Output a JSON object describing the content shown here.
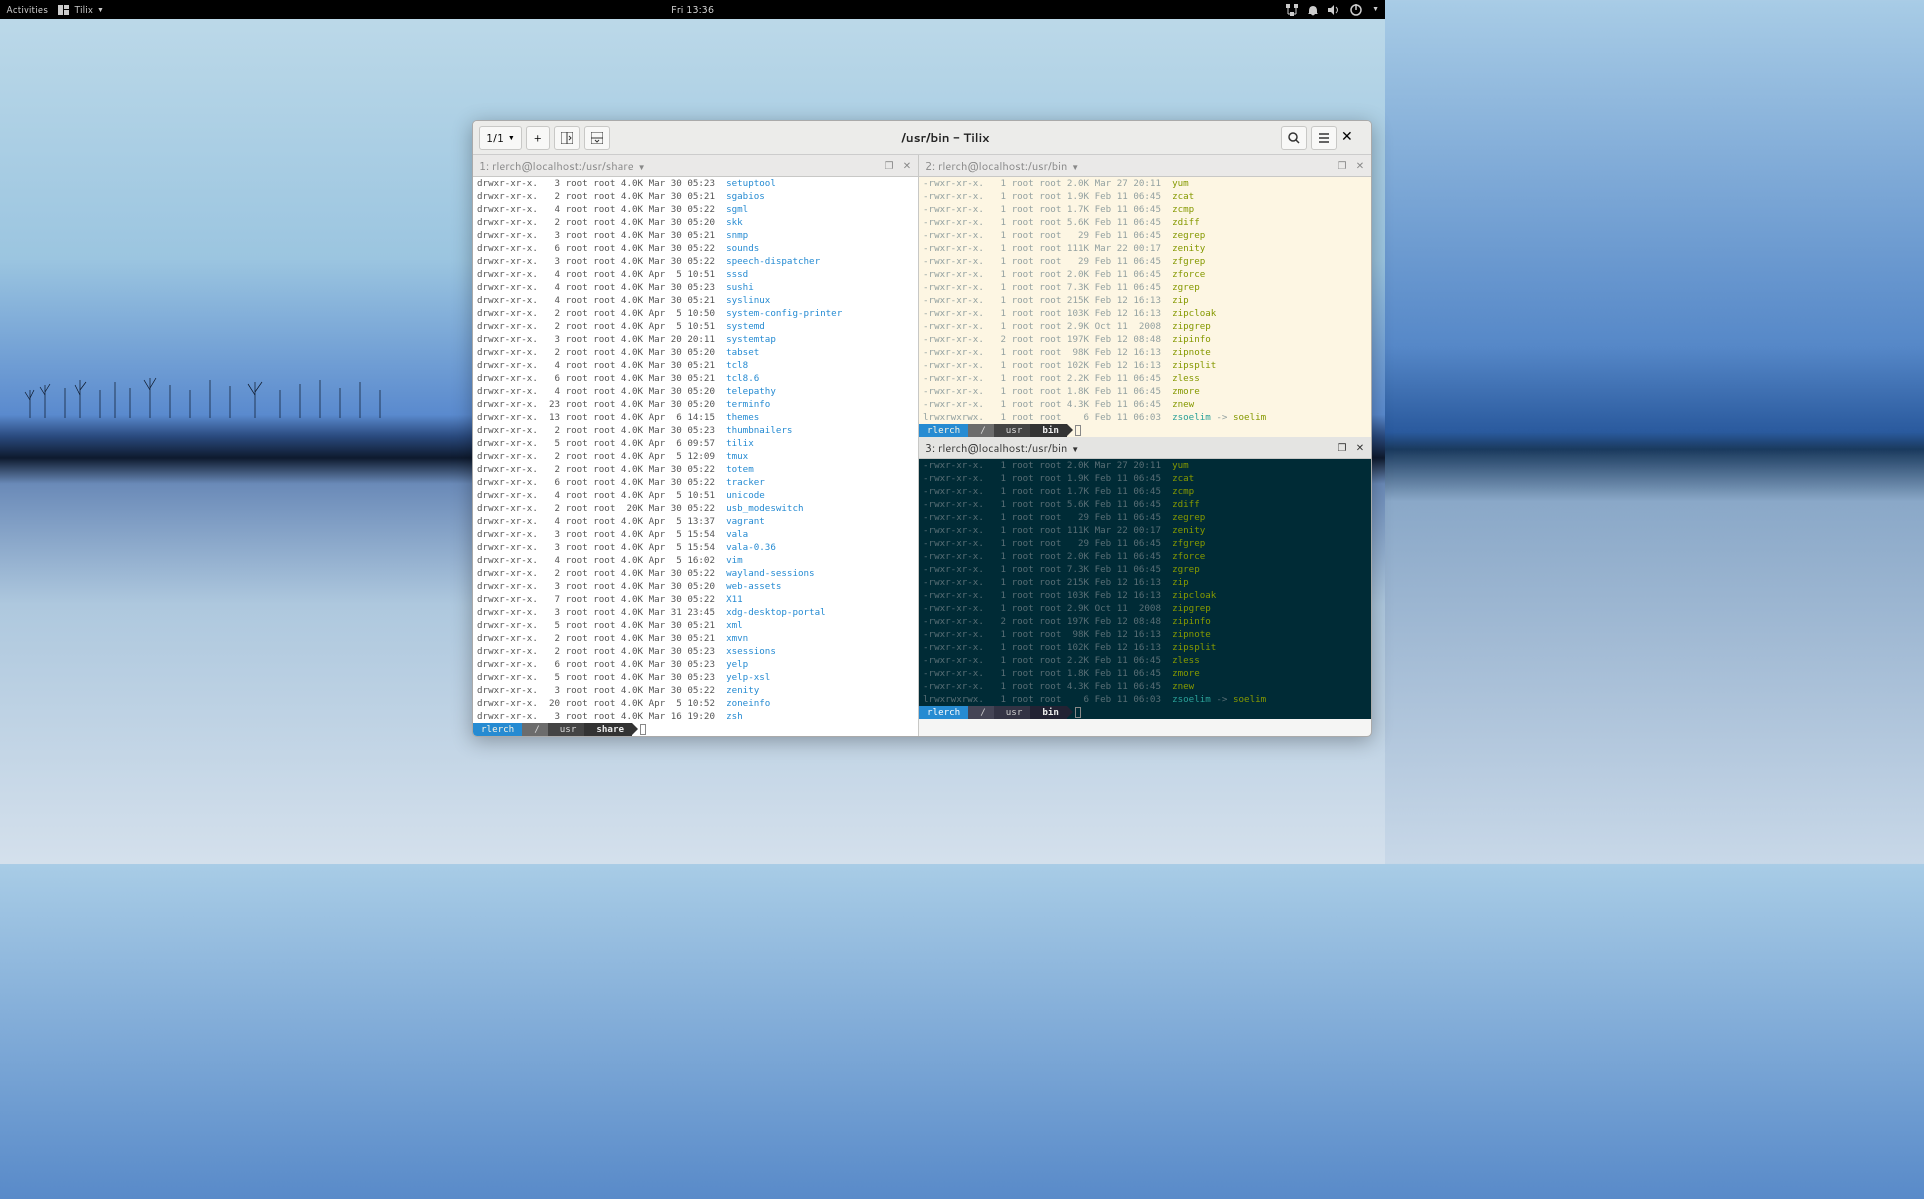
{
  "topbar": {
    "activities": "Activities",
    "app": "Tilix",
    "clock": "Fri 13:36"
  },
  "window": {
    "title": "/usr/bin - Tilix",
    "session_label": "1/1"
  },
  "panes": {
    "p1": {
      "index": "1:",
      "title": "rlerch@localhost:/usr/share"
    },
    "p2": {
      "index": "2:",
      "title": "rlerch@localhost:/usr/bin"
    },
    "p3": {
      "index": "3:",
      "title": "rlerch@localhost:/usr/bin"
    }
  },
  "prompt": {
    "user": "rlerch",
    "sep": "/",
    "usr": "usr",
    "share": "share",
    "bin": "bin"
  },
  "ls_share": [
    {
      "p": "drwxr-xr-x.",
      "n": "3",
      "o": "root root",
      "s": "4.0K",
      "d": "Mar 30 05:23",
      "f": "setuptool",
      "t": "dir"
    },
    {
      "p": "drwxr-xr-x.",
      "n": "2",
      "o": "root root",
      "s": "4.0K",
      "d": "Mar 30 05:21",
      "f": "sgabios",
      "t": "dir"
    },
    {
      "p": "drwxr-xr-x.",
      "n": "4",
      "o": "root root",
      "s": "4.0K",
      "d": "Mar 30 05:22",
      "f": "sgml",
      "t": "dir"
    },
    {
      "p": "drwxr-xr-x.",
      "n": "2",
      "o": "root root",
      "s": "4.0K",
      "d": "Mar 30 05:20",
      "f": "skk",
      "t": "dir"
    },
    {
      "p": "drwxr-xr-x.",
      "n": "3",
      "o": "root root",
      "s": "4.0K",
      "d": "Mar 30 05:21",
      "f": "snmp",
      "t": "dir"
    },
    {
      "p": "drwxr-xr-x.",
      "n": "6",
      "o": "root root",
      "s": "4.0K",
      "d": "Mar 30 05:22",
      "f": "sounds",
      "t": "dir"
    },
    {
      "p": "drwxr-xr-x.",
      "n": "3",
      "o": "root root",
      "s": "4.0K",
      "d": "Mar 30 05:22",
      "f": "speech-dispatcher",
      "t": "dir"
    },
    {
      "p": "drwxr-xr-x.",
      "n": "4",
      "o": "root root",
      "s": "4.0K",
      "d": "Apr  5 10:51",
      "f": "sssd",
      "t": "dir"
    },
    {
      "p": "drwxr-xr-x.",
      "n": "4",
      "o": "root root",
      "s": "4.0K",
      "d": "Mar 30 05:23",
      "f": "sushi",
      "t": "dir"
    },
    {
      "p": "drwxr-xr-x.",
      "n": "4",
      "o": "root root",
      "s": "4.0K",
      "d": "Mar 30 05:21",
      "f": "syslinux",
      "t": "dir"
    },
    {
      "p": "drwxr-xr-x.",
      "n": "2",
      "o": "root root",
      "s": "4.0K",
      "d": "Apr  5 10:50",
      "f": "system-config-printer",
      "t": "dir"
    },
    {
      "p": "drwxr-xr-x.",
      "n": "2",
      "o": "root root",
      "s": "4.0K",
      "d": "Apr  5 10:51",
      "f": "systemd",
      "t": "dir"
    },
    {
      "p": "drwxr-xr-x.",
      "n": "3",
      "o": "root root",
      "s": "4.0K",
      "d": "Mar 20 20:11",
      "f": "systemtap",
      "t": "dir"
    },
    {
      "p": "drwxr-xr-x.",
      "n": "2",
      "o": "root root",
      "s": "4.0K",
      "d": "Mar 30 05:20",
      "f": "tabset",
      "t": "dir"
    },
    {
      "p": "drwxr-xr-x.",
      "n": "4",
      "o": "root root",
      "s": "4.0K",
      "d": "Mar 30 05:21",
      "f": "tcl8",
      "t": "dir"
    },
    {
      "p": "drwxr-xr-x.",
      "n": "6",
      "o": "root root",
      "s": "4.0K",
      "d": "Mar 30 05:21",
      "f": "tcl8.6",
      "t": "dir"
    },
    {
      "p": "drwxr-xr-x.",
      "n": "4",
      "o": "root root",
      "s": "4.0K",
      "d": "Mar 30 05:20",
      "f": "telepathy",
      "t": "dir"
    },
    {
      "p": "drwxr-xr-x.",
      "n": "23",
      "o": "root root",
      "s": "4.0K",
      "d": "Mar 30 05:20",
      "f": "terminfo",
      "t": "dir"
    },
    {
      "p": "drwxr-xr-x.",
      "n": "13",
      "o": "root root",
      "s": "4.0K",
      "d": "Apr  6 14:15",
      "f": "themes",
      "t": "dir"
    },
    {
      "p": "drwxr-xr-x.",
      "n": "2",
      "o": "root root",
      "s": "4.0K",
      "d": "Mar 30 05:23",
      "f": "thumbnailers",
      "t": "dir"
    },
    {
      "p": "drwxr-xr-x.",
      "n": "5",
      "o": "root root",
      "s": "4.0K",
      "d": "Apr  6 09:57",
      "f": "tilix",
      "t": "dir"
    },
    {
      "p": "drwxr-xr-x.",
      "n": "2",
      "o": "root root",
      "s": "4.0K",
      "d": "Apr  5 12:09",
      "f": "tmux",
      "t": "dir"
    },
    {
      "p": "drwxr-xr-x.",
      "n": "2",
      "o": "root root",
      "s": "4.0K",
      "d": "Mar 30 05:22",
      "f": "totem",
      "t": "dir"
    },
    {
      "p": "drwxr-xr-x.",
      "n": "6",
      "o": "root root",
      "s": "4.0K",
      "d": "Mar 30 05:22",
      "f": "tracker",
      "t": "dir"
    },
    {
      "p": "drwxr-xr-x.",
      "n": "4",
      "o": "root root",
      "s": "4.0K",
      "d": "Apr  5 10:51",
      "f": "unicode",
      "t": "dir"
    },
    {
      "p": "drwxr-xr-x.",
      "n": "2",
      "o": "root root",
      "s": " 20K",
      "d": "Mar 30 05:22",
      "f": "usb_modeswitch",
      "t": "dir"
    },
    {
      "p": "drwxr-xr-x.",
      "n": "4",
      "o": "root root",
      "s": "4.0K",
      "d": "Apr  5 13:37",
      "f": "vagrant",
      "t": "dir"
    },
    {
      "p": "drwxr-xr-x.",
      "n": "3",
      "o": "root root",
      "s": "4.0K",
      "d": "Apr  5 15:54",
      "f": "vala",
      "t": "dir"
    },
    {
      "p": "drwxr-xr-x.",
      "n": "3",
      "o": "root root",
      "s": "4.0K",
      "d": "Apr  5 15:54",
      "f": "vala-0.36",
      "t": "dir"
    },
    {
      "p": "drwxr-xr-x.",
      "n": "4",
      "o": "root root",
      "s": "4.0K",
      "d": "Apr  5 16:02",
      "f": "vim",
      "t": "dir"
    },
    {
      "p": "drwxr-xr-x.",
      "n": "2",
      "o": "root root",
      "s": "4.0K",
      "d": "Mar 30 05:22",
      "f": "wayland-sessions",
      "t": "dir"
    },
    {
      "p": "drwxr-xr-x.",
      "n": "3",
      "o": "root root",
      "s": "4.0K",
      "d": "Mar 30 05:20",
      "f": "web-assets",
      "t": "dir"
    },
    {
      "p": "drwxr-xr-x.",
      "n": "7",
      "o": "root root",
      "s": "4.0K",
      "d": "Mar 30 05:22",
      "f": "X11",
      "t": "dir"
    },
    {
      "p": "drwxr-xr-x.",
      "n": "3",
      "o": "root root",
      "s": "4.0K",
      "d": "Mar 31 23:45",
      "f": "xdg-desktop-portal",
      "t": "dir"
    },
    {
      "p": "drwxr-xr-x.",
      "n": "5",
      "o": "root root",
      "s": "4.0K",
      "d": "Mar 30 05:21",
      "f": "xml",
      "t": "dir"
    },
    {
      "p": "drwxr-xr-x.",
      "n": "2",
      "o": "root root",
      "s": "4.0K",
      "d": "Mar 30 05:21",
      "f": "xmvn",
      "t": "dir"
    },
    {
      "p": "drwxr-xr-x.",
      "n": "2",
      "o": "root root",
      "s": "4.0K",
      "d": "Mar 30 05:23",
      "f": "xsessions",
      "t": "dir"
    },
    {
      "p": "drwxr-xr-x.",
      "n": "6",
      "o": "root root",
      "s": "4.0K",
      "d": "Mar 30 05:23",
      "f": "yelp",
      "t": "dir"
    },
    {
      "p": "drwxr-xr-x.",
      "n": "5",
      "o": "root root",
      "s": "4.0K",
      "d": "Mar 30 05:23",
      "f": "yelp-xsl",
      "t": "dir"
    },
    {
      "p": "drwxr-xr-x.",
      "n": "3",
      "o": "root root",
      "s": "4.0K",
      "d": "Mar 30 05:22",
      "f": "zenity",
      "t": "dir"
    },
    {
      "p": "drwxr-xr-x.",
      "n": "20",
      "o": "root root",
      "s": "4.0K",
      "d": "Apr  5 10:52",
      "f": "zoneinfo",
      "t": "dir"
    },
    {
      "p": "drwxr-xr-x.",
      "n": "3",
      "o": "root root",
      "s": "4.0K",
      "d": "Mar 16 19:20",
      "f": "zsh",
      "t": "dir"
    }
  ],
  "ls_bin": [
    {
      "p": "-rwxr-xr-x.",
      "n": "1",
      "o": "root root",
      "s": "2.0K",
      "d": "Mar 27 20:11",
      "f": "yum",
      "t": "exe"
    },
    {
      "p": "-rwxr-xr-x.",
      "n": "1",
      "o": "root root",
      "s": "1.9K",
      "d": "Feb 11 06:45",
      "f": "zcat",
      "t": "exe"
    },
    {
      "p": "-rwxr-xr-x.",
      "n": "1",
      "o": "root root",
      "s": "1.7K",
      "d": "Feb 11 06:45",
      "f": "zcmp",
      "t": "exe"
    },
    {
      "p": "-rwxr-xr-x.",
      "n": "1",
      "o": "root root",
      "s": "5.6K",
      "d": "Feb 11 06:45",
      "f": "zdiff",
      "t": "exe"
    },
    {
      "p": "-rwxr-xr-x.",
      "n": "1",
      "o": "root root",
      "s": "  29",
      "d": "Feb 11 06:45",
      "f": "zegrep",
      "t": "exe"
    },
    {
      "p": "-rwxr-xr-x.",
      "n": "1",
      "o": "root root",
      "s": "111K",
      "d": "Mar 22 00:17",
      "f": "zenity",
      "t": "exe"
    },
    {
      "p": "-rwxr-xr-x.",
      "n": "1",
      "o": "root root",
      "s": "  29",
      "d": "Feb 11 06:45",
      "f": "zfgrep",
      "t": "exe"
    },
    {
      "p": "-rwxr-xr-x.",
      "n": "1",
      "o": "root root",
      "s": "2.0K",
      "d": "Feb 11 06:45",
      "f": "zforce",
      "t": "exe"
    },
    {
      "p": "-rwxr-xr-x.",
      "n": "1",
      "o": "root root",
      "s": "7.3K",
      "d": "Feb 11 06:45",
      "f": "zgrep",
      "t": "exe"
    },
    {
      "p": "-rwxr-xr-x.",
      "n": "1",
      "o": "root root",
      "s": "215K",
      "d": "Feb 12 16:13",
      "f": "zip",
      "t": "exe"
    },
    {
      "p": "-rwxr-xr-x.",
      "n": "1",
      "o": "root root",
      "s": "103K",
      "d": "Feb 12 16:13",
      "f": "zipcloak",
      "t": "exe"
    },
    {
      "p": "-rwxr-xr-x.",
      "n": "1",
      "o": "root root",
      "s": "2.9K",
      "d": "Oct 11  2008",
      "f": "zipgrep",
      "t": "exe"
    },
    {
      "p": "-rwxr-xr-x.",
      "n": "2",
      "o": "root root",
      "s": "197K",
      "d": "Feb 12 08:48",
      "f": "zipinfo",
      "t": "exe"
    },
    {
      "p": "-rwxr-xr-x.",
      "n": "1",
      "o": "root root",
      "s": " 98K",
      "d": "Feb 12 16:13",
      "f": "zipnote",
      "t": "exe"
    },
    {
      "p": "-rwxr-xr-x.",
      "n": "1",
      "o": "root root",
      "s": "102K",
      "d": "Feb 12 16:13",
      "f": "zipsplit",
      "t": "exe"
    },
    {
      "p": "-rwxr-xr-x.",
      "n": "1",
      "o": "root root",
      "s": "2.2K",
      "d": "Feb 11 06:45",
      "f": "zless",
      "t": "exe"
    },
    {
      "p": "-rwxr-xr-x.",
      "n": "1",
      "o": "root root",
      "s": "1.8K",
      "d": "Feb 11 06:45",
      "f": "zmore",
      "t": "exe"
    },
    {
      "p": "-rwxr-xr-x.",
      "n": "1",
      "o": "root root",
      "s": "4.3K",
      "d": "Feb 11 06:45",
      "f": "znew",
      "t": "exe"
    },
    {
      "p": "lrwxrwxrwx.",
      "n": "1",
      "o": "root root",
      "s": "   6",
      "d": "Feb 11 06:03",
      "f": "zsoelim",
      "t": "lnk",
      "target": "soelim"
    }
  ]
}
